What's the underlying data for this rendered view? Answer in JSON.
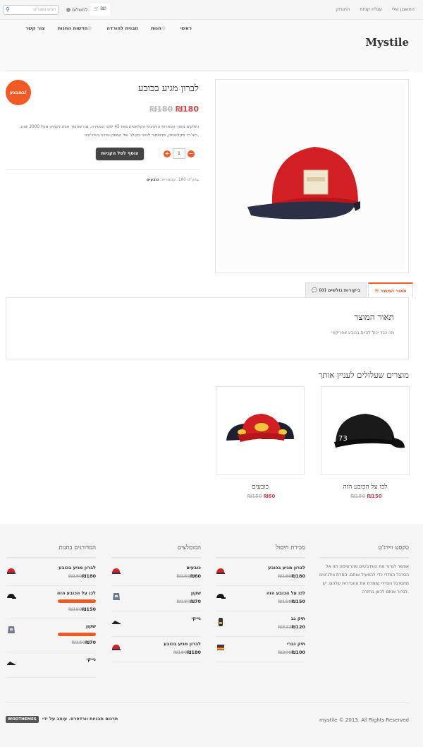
{
  "topbar": {
    "links": [
      "החשבון שלי",
      "עגלת קניות",
      "התנתק"
    ],
    "search_placeholder": "חפש מוצרים",
    "cart": "₪0",
    "checkout": "לתשלום"
  },
  "header": {
    "logo": "Mystile",
    "nav": [
      "ראשי",
      "חנות",
      "תבנית להורדה",
      "חדשות החנות",
      "צור קשר"
    ]
  },
  "product": {
    "title": "לברון מגיע בכובע",
    "old_price": "₪180",
    "new_price": "₪180",
    "description": "וחלקים מתוך הספרות הלטינית הקלאסית מאז 45 לפני הספירה. מה שהופך אותו לעתיק מעל 2000 שנה. ריצ'רד מקלינטוק, פרופסור לטיני בקולג' של המפדן-סידני בוירג'יניה,",
    "sale_badge": "במבצע!",
    "add_to_cart": "הוסף לסל הקניות",
    "qty": "1",
    "meta_prefix": "מק\"ט 180. קטגוריה:",
    "meta_category": "כובעים."
  },
  "tabs": {
    "description": "תאור המוצר",
    "reviews": "ביקורות גולשים (0)",
    "panel_title": "תאור המוצר",
    "panel_text": "מה כבר יכול להיות בכובע אפריקאי"
  },
  "related": {
    "title": "מוצרים שעלולים לעניין אותך",
    "items": [
      {
        "name": "לכו על הכובע הזה",
        "old": "₪150",
        "new": "₪150"
      },
      {
        "name": "כובעים",
        "old": "₪150",
        "new": "₪60"
      }
    ]
  },
  "footer": {
    "widget_text_title": "טקסט ווידג'ט",
    "widget_text": "אפשר לגרור את הווידג'טים מהרשימה הזו אל הסרגל הצדדי כדי להפעיל אותם. הסרת ווידג'טים מהסרגל הצדדי שומרת את ההגדרות שלהם. יש לגרור אותם לכאן בחזרה.",
    "sale_title": "מכירת חיסול",
    "sale_items": [
      {
        "name": "לברון מגיע בכובע",
        "old": "₪180",
        "new": "₪180"
      },
      {
        "name": "לכו על הכובע הזה",
        "old": "₪150",
        "new": "₪150"
      },
      {
        "name": "תיק גב",
        "old": "₪322",
        "new": "₪120"
      },
      {
        "name": "תיק גברי",
        "old": "₪200",
        "new": "₪100"
      }
    ],
    "featured_title": "המומלצים",
    "featured_items": [
      {
        "name": "כובעים",
        "old": "₪150",
        "new": "₪60"
      },
      {
        "name": "שקון",
        "old": "₪150",
        "new": "₪70"
      },
      {
        "name": "נייקי",
        "old": "",
        "new": ""
      },
      {
        "name": "לברון מגיע בכובע",
        "old": "₪180",
        "new": "₪180"
      }
    ],
    "rated_title": "המדורגים בחנות",
    "rated_items": [
      {
        "name": "לברון מגיע בכובע",
        "old": "₪180",
        "new": "₪180"
      },
      {
        "name": "לכו על הכובע הזה",
        "old": "₪150",
        "new": "₪150"
      },
      {
        "name": "שקון",
        "old": "₪150",
        "new": "₪70"
      },
      {
        "name": "נייקי",
        "old": "",
        "new": ""
      }
    ],
    "copyright": "mystile © 2013. All Rights Reserved",
    "credits": "תרגום תבניות וורדפרס. עוצב על ידי",
    "woo": "WOOTHEMES"
  },
  "colors": {
    "accent": "#f15a24",
    "price": "#cc4444"
  }
}
